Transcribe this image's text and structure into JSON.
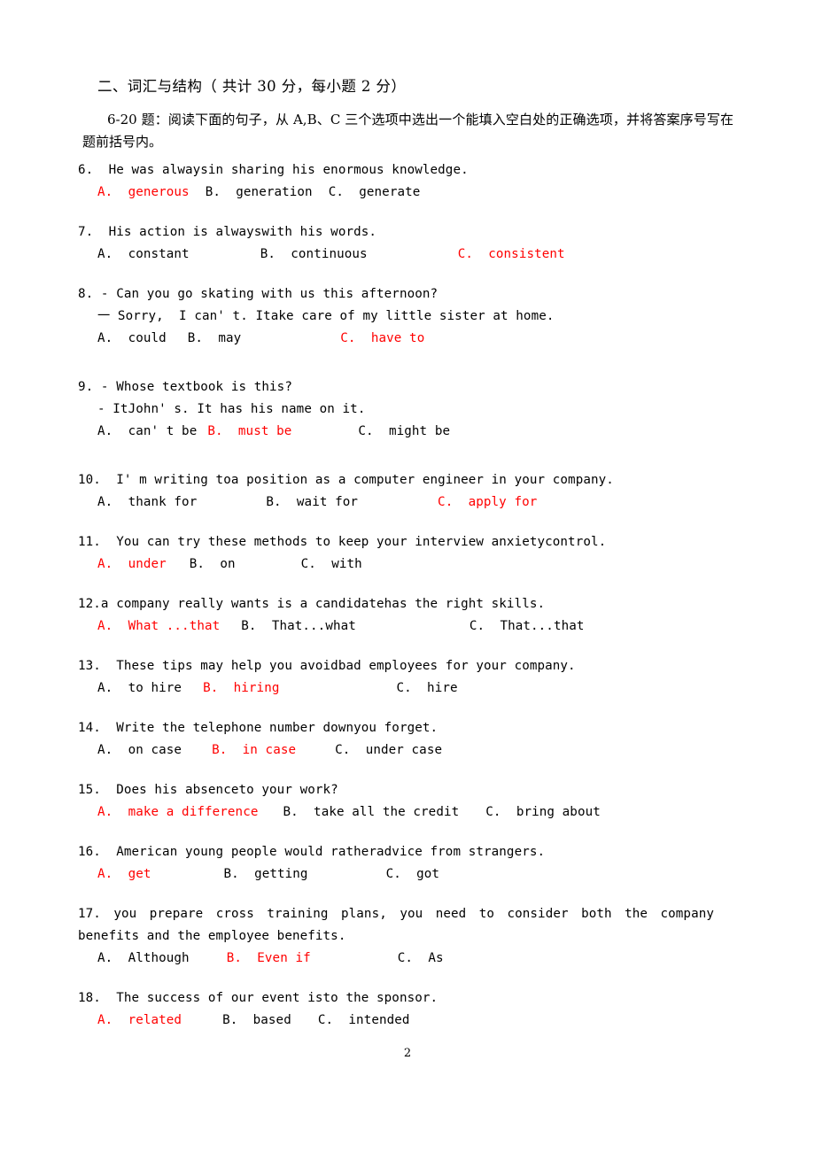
{
  "section": {
    "heading": "二、词汇与结构（ 共计 30 分，每小题 2 分）",
    "instruction": "6-20 题：阅读下面的句子，从 A,B、C 三个选项中选出一个能填入空白处的正确选项，并将答案序号写在题前括号内。"
  },
  "answer_color": "#ff0000",
  "questions": [
    {
      "number": "6.",
      "stem": "6.  He was alwaysin sharing his enormous knowledge.",
      "options": [
        {
          "label": "A.  generous",
          "correct": true,
          "gap": 0
        },
        {
          "label": "B.  generation",
          "correct": false,
          "gap": 18
        },
        {
          "label": "C.  generate",
          "correct": false,
          "gap": 18
        }
      ]
    },
    {
      "number": "7.",
      "stem": "7.  His action is alwayswith his words.",
      "options": [
        {
          "label": "A.  constant",
          "correct": false,
          "gap": 0
        },
        {
          "label": "B.  continuous",
          "correct": false,
          "gap": 80
        },
        {
          "label": "C.  consistent",
          "correct": true,
          "gap": 102
        }
      ]
    },
    {
      "number": "8.",
      "stem": "8. - Can you go skating with us this afternoon?",
      "sub": "一 Sorry,  I can' t. Itake care of my little sister at home.",
      "options": [
        {
          "label": "A.  could",
          "correct": false,
          "gap": 0
        },
        {
          "label": "B.  may",
          "correct": false,
          "gap": 24
        },
        {
          "label": "C.  have to",
          "correct": true,
          "gap": 112
        }
      ]
    },
    {
      "number": "9.",
      "stem": "9. - Whose textbook is this?",
      "sub": "- ItJohn' s. It has his name on it.",
      "options": [
        {
          "label": "A.  can' t be",
          "correct": false,
          "gap": 0
        },
        {
          "label": "B.  must be",
          "correct": true,
          "gap": 12
        },
        {
          "label": "C.  might be",
          "correct": false,
          "gap": 75
        }
      ]
    },
    {
      "number": "10.",
      "stem": "10.  I' m writing toa position as a computer engineer in your company.",
      "options": [
        {
          "label": "A.  thank for",
          "correct": false,
          "gap": 0
        },
        {
          "label": "B.  wait for",
          "correct": false,
          "gap": 78
        },
        {
          "label": "C.  apply for",
          "correct": true,
          "gap": 90
        }
      ]
    },
    {
      "number": "11.",
      "stem": "11.  You can try these methods to keep your interview anxietycontrol.",
      "options": [
        {
          "label": "A.  under",
          "correct": true,
          "gap": 0
        },
        {
          "label": "B.  on",
          "correct": false,
          "gap": 26
        },
        {
          "label": "C.  with",
          "correct": false,
          "gap": 74
        }
      ]
    },
    {
      "number": "12.",
      "stem": "12.a company really wants is a candidatehas the right skills.",
      "options": [
        {
          "label": "A.  What ...that",
          "correct": true,
          "gap": 0
        },
        {
          "label": "B.  That...what",
          "correct": false,
          "gap": 24
        },
        {
          "label": "C.  That...that",
          "correct": false,
          "gap": 128
        }
      ]
    },
    {
      "number": "13.",
      "stem": "13.  These tips may help you avoidbad employees for your company.",
      "options": [
        {
          "label": "A.  to hire",
          "correct": false,
          "gap": 0
        },
        {
          "label": "B.  hiring",
          "correct": true,
          "gap": 24
        },
        {
          "label": "C.  hire",
          "correct": false,
          "gap": 132
        }
      ]
    },
    {
      "number": "14.",
      "stem": "14.  Write the telephone number downyou forget.",
      "options": [
        {
          "label": "A.  on case",
          "correct": false,
          "gap": 0
        },
        {
          "label": "B.  in case",
          "correct": true,
          "gap": 34
        },
        {
          "label": "C.  under case",
          "correct": false,
          "gap": 44
        }
      ]
    },
    {
      "number": "15.",
      "stem": "15.  Does his absenceto your work?",
      "options": [
        {
          "label": "A.  make a difference",
          "correct": true,
          "gap": 0
        },
        {
          "label": "B.  take all the credit",
          "correct": false,
          "gap": 28
        },
        {
          "label": "C.  bring about",
          "correct": false,
          "gap": 30
        }
      ]
    },
    {
      "number": "16.",
      "stem": "16.  American young people would ratheradvice from strangers.",
      "options": [
        {
          "label": "A.  get",
          "correct": true,
          "gap": 0
        },
        {
          "label": "B.  getting",
          "correct": false,
          "gap": 82
        },
        {
          "label": "C.  got",
          "correct": false,
          "gap": 88
        }
      ]
    },
    {
      "number": "17.",
      "stem": "17.  you prepare cross training plans, you need to consider both the company benefits and the employee benefits.",
      "wrap": true,
      "options": [
        {
          "label": "A.  Although",
          "correct": false,
          "gap": 0
        },
        {
          "label": "B.  Even if",
          "correct": true,
          "gap": 42
        },
        {
          "label": "C.  As",
          "correct": false,
          "gap": 98
        }
      ]
    },
    {
      "number": "18.",
      "stem": "18.  The success of our event isto the sponsor.",
      "options": [
        {
          "label": "A.  related",
          "correct": true,
          "gap": 0
        },
        {
          "label": "B.  based",
          "correct": false,
          "gap": 46
        },
        {
          "label": "C.  intended",
          "correct": false,
          "gap": 30
        }
      ]
    }
  ],
  "footer": {
    "page_number": "2"
  }
}
